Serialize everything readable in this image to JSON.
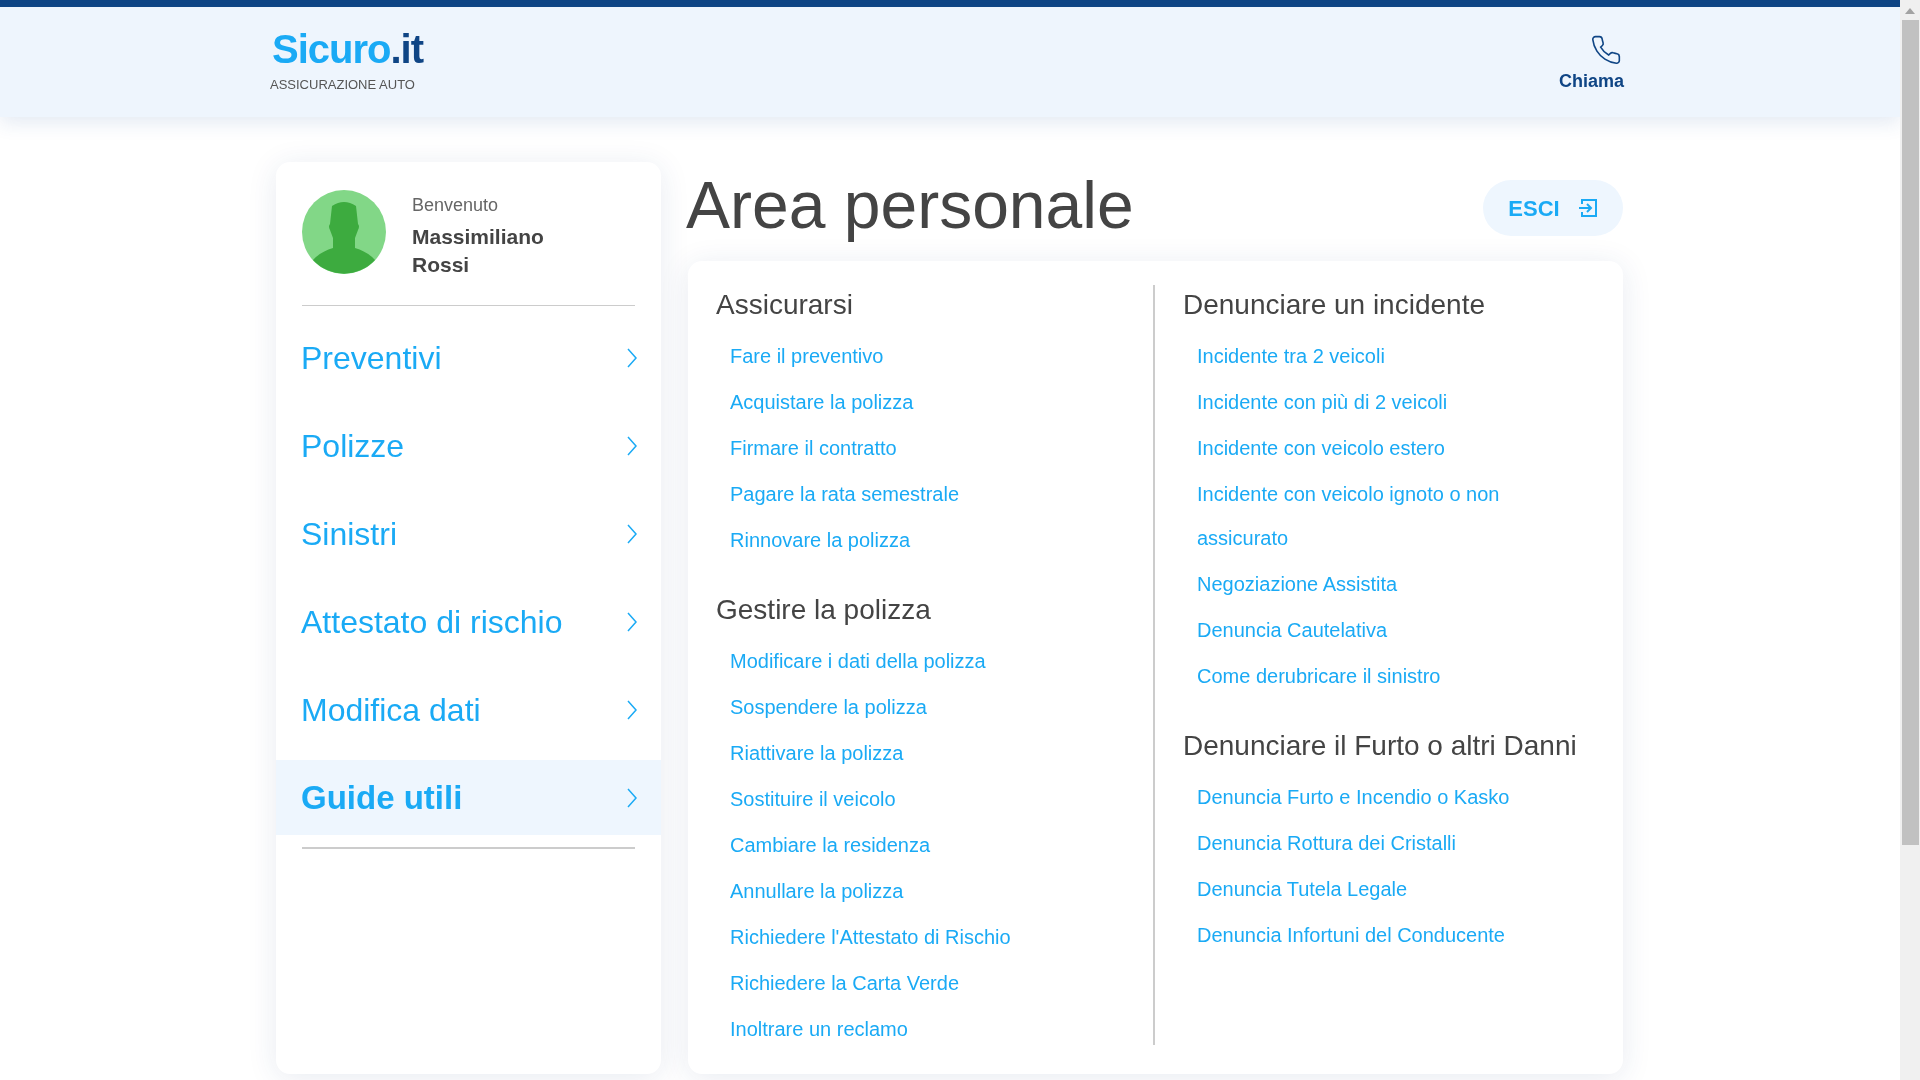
{
  "header": {
    "logo_main": "Sicuro",
    "logo_suffix": ".it",
    "tagline": "ASSICURAZIONE AUTO",
    "call_label": "Chiama"
  },
  "sidebar": {
    "greeting": "Benvenuto",
    "name": "Massimiliano Rossi",
    "items": [
      {
        "label": "Preventivi",
        "selected": false
      },
      {
        "label": "Polizze",
        "selected": false
      },
      {
        "label": "Sinistri",
        "selected": false
      },
      {
        "label": "Attestato di rischio",
        "selected": false
      },
      {
        "label": "Modifica dati",
        "selected": false
      },
      {
        "label": "Guide utili",
        "selected": true
      }
    ]
  },
  "main": {
    "title": "Area personale",
    "logout_label": "ESCI",
    "columns": [
      {
        "sections": [
          {
            "heading": "Assicurarsi",
            "links": [
              "Fare il preventivo",
              "Acquistare la polizza",
              "Firmare il contratto",
              "Pagare la rata semestrale",
              "Rinnovare la polizza"
            ]
          },
          {
            "heading": "Gestire la polizza",
            "links": [
              "Modificare i dati della polizza",
              "Sospendere la polizza",
              "Riattivare la polizza",
              "Sostituire il veicolo",
              "Cambiare la residenza",
              "Annullare la polizza",
              "Richiedere l'Attestato di Rischio",
              "Richiedere la Carta Verde",
              "Inoltrare un reclamo"
            ]
          }
        ]
      },
      {
        "sections": [
          {
            "heading": "Denunciare un incidente",
            "links": [
              "Incidente tra 2 veicoli",
              "Incidente con più di 2 veicoli",
              "Incidente con veicolo estero",
              "Incidente con veicolo ignoto o non assicurato",
              "Negoziazione Assistita",
              "Denuncia Cautelativa",
              "Come derubricare il sinistro"
            ]
          },
          {
            "heading": "Denunciare il Furto o altri Danni",
            "links": [
              "Denuncia Furto e Incendio o Kasko",
              "Denuncia Rottura dei Cristalli",
              "Denuncia Tutela Legale",
              "Denuncia Infortuni del Conducente"
            ]
          }
        ]
      }
    ]
  }
}
